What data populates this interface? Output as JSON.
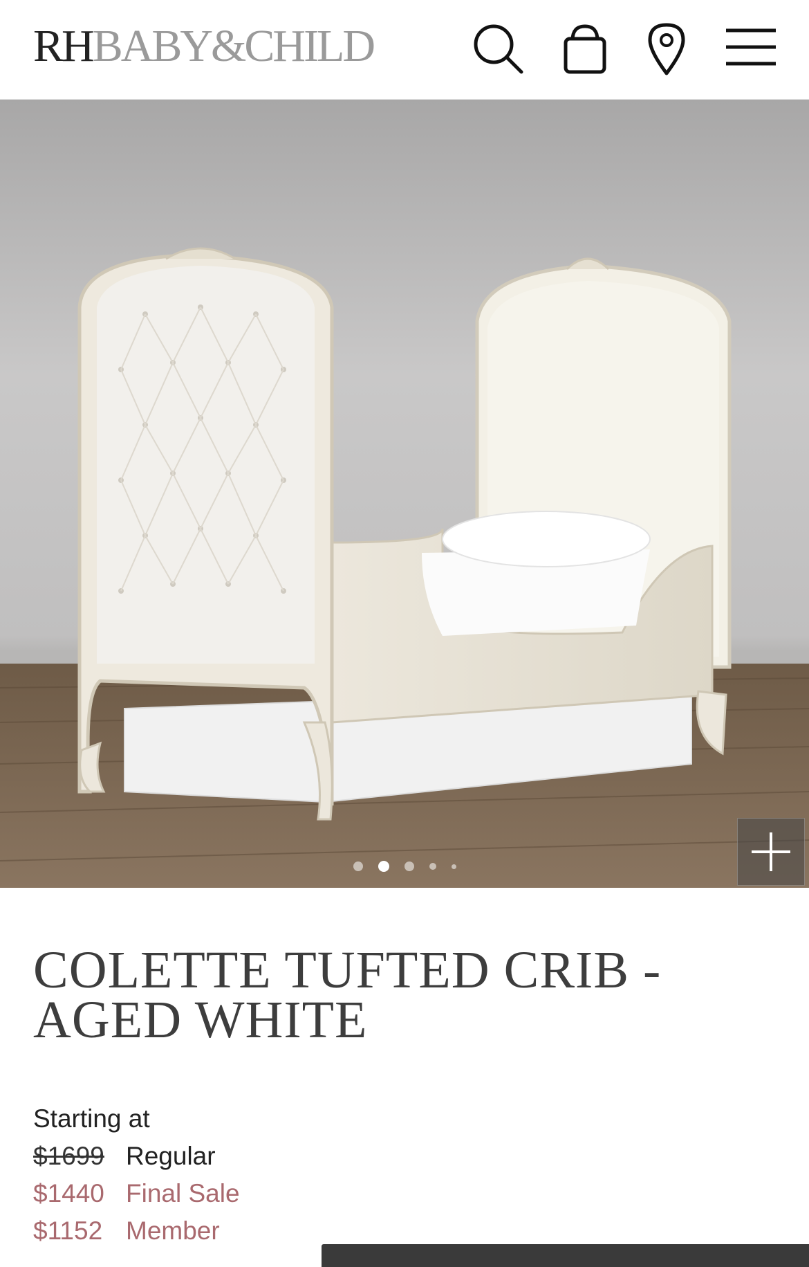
{
  "header": {
    "logo_rh": "RH",
    "logo_brand": "BABY&CHILD",
    "icons": [
      "search-icon",
      "shopping-bag-icon",
      "map-pin-icon",
      "hamburger-menu-icon"
    ]
  },
  "hero": {
    "carousel_total": 5,
    "carousel_active": 2,
    "zoom_icon": "plus-icon"
  },
  "product": {
    "title": "COLETTE TUFTED CRIB - AGED WHITE",
    "starting_label": "Starting at",
    "regular_price": "$1699",
    "regular_label": "Regular",
    "sale_price": "$1440",
    "sale_label": "Final Sale",
    "member_price": "$1152",
    "member_label": "Member"
  },
  "colors": {
    "sale_accent": "#a9696e",
    "logo_gray": "#9a9a9a",
    "text_dark": "#3d3d3d"
  }
}
